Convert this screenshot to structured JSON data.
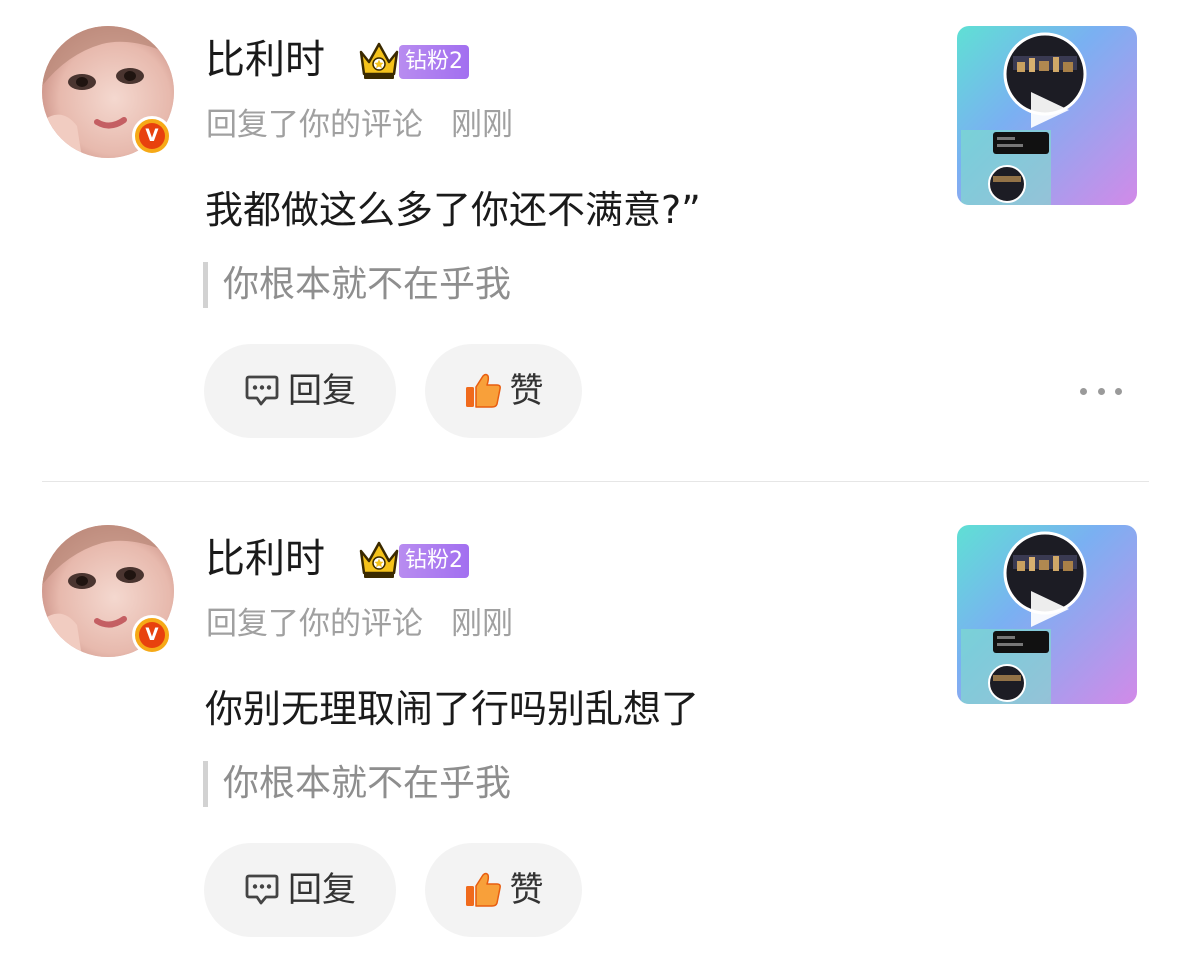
{
  "comments": [
    {
      "username": "比利时",
      "fan_badge": "钻粉2",
      "verified_mark": "V",
      "action": "回复了你的评论",
      "time": "刚刚",
      "text": "我都做这么多了你还不满意?”",
      "quoted": "你根本就不在乎我",
      "reply_label": "回复",
      "like_label": "赞",
      "has_more": true
    },
    {
      "username": "比利时",
      "fan_badge": "钻粉2",
      "verified_mark": "V",
      "action": "回复了你的评论",
      "time": "刚刚",
      "text": "你别无理取闹了行吗别乱想了",
      "quoted": "你根本就不在乎我",
      "reply_label": "回复",
      "like_label": "赞",
      "has_more": false
    }
  ],
  "icons": {
    "verified": "verified-v-icon",
    "crown": "crown-icon",
    "reply": "comment-bubble-icon",
    "like": "thumbs-up-icon",
    "more": "more-dots-icon",
    "play": "play-icon"
  },
  "colors": {
    "badge_purple": "#a26ff0",
    "verified_orange": "#f6a917",
    "like_orange": "#f06a1c",
    "secondary_text": "#a0a0a0"
  }
}
